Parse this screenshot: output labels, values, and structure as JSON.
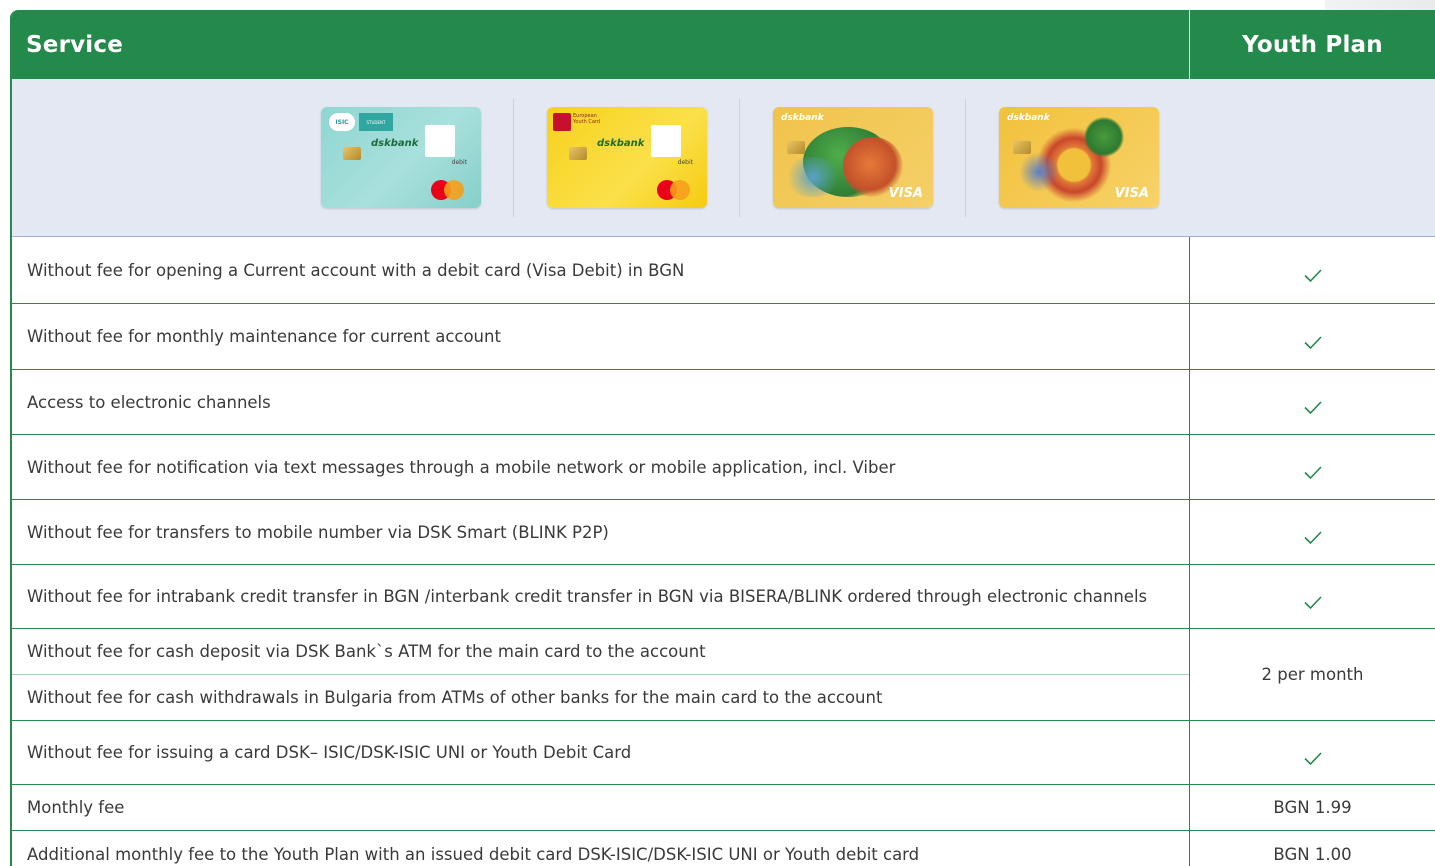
{
  "header": {
    "service": "Service",
    "plan": "Youth Plan"
  },
  "cards": [
    {
      "name": "DSK-ISIC debit card",
      "kind": "isic",
      "badge": "ISIC",
      "brand": "dskbank",
      "label": "debit"
    },
    {
      "name": "European Youth Card debit card",
      "kind": "eyc",
      "brand": "dskbank",
      "label": "debit",
      "issuer": "European Youth Card"
    },
    {
      "name": "DSK start Visa card",
      "kind": "start",
      "brand": "dskbank",
      "network": "VISA"
    },
    {
      "name": "DSK teen Visa card",
      "kind": "teen",
      "brand": "dskbank",
      "network": "VISA"
    }
  ],
  "rows": [
    {
      "service": "Without fee for opening a Current account with a debit card (Visa Debit) in BGN",
      "value": "check"
    },
    {
      "service": "Without fee for monthly maintenance for current account",
      "value": "check"
    },
    {
      "service": "Access to electronic channels",
      "value": "check"
    },
    {
      "service": "Without fee for notification via text messages through a mobile network or mobile application, incl. Viber",
      "value": "check"
    },
    {
      "service": "Without fee for transfers to mobile number via DSK Smart (BLINK P2P)",
      "value": "check"
    },
    {
      "service": "Without fee for intrabank credit transfer in BGN /interbank credit transfer in BGN via BISERA/BLINK ordered through electronic channels",
      "value": "check"
    }
  ],
  "merged": {
    "services": [
      "Without fee for cash deposit via DSK Bank`s ATM  for the main card to the account",
      "Without  fee for cash withdrawals in Bulgaria from ATMs of other banks for the main card to the account"
    ],
    "value": "2 per month"
  },
  "rows_after": [
    {
      "service": "Without fee for issuing a card DSK– ISIC/DSK-ISIC UNI or Youth Debit Card",
      "value": "check"
    },
    {
      "service": "Monthly fee",
      "value": "BGN 1.99"
    },
    {
      "service": "Additional monthly fee to the Youth Plan with an issued debit card  DSK-ISIC/DSK-ISIC UNI or Youth debit card",
      "value": "BGN 1.00"
    }
  ],
  "colors": {
    "brand_green": "#238a4b",
    "cards_bg": "#e4e8f2",
    "check": "#238a4b"
  },
  "icons": {
    "included": "check-icon"
  }
}
